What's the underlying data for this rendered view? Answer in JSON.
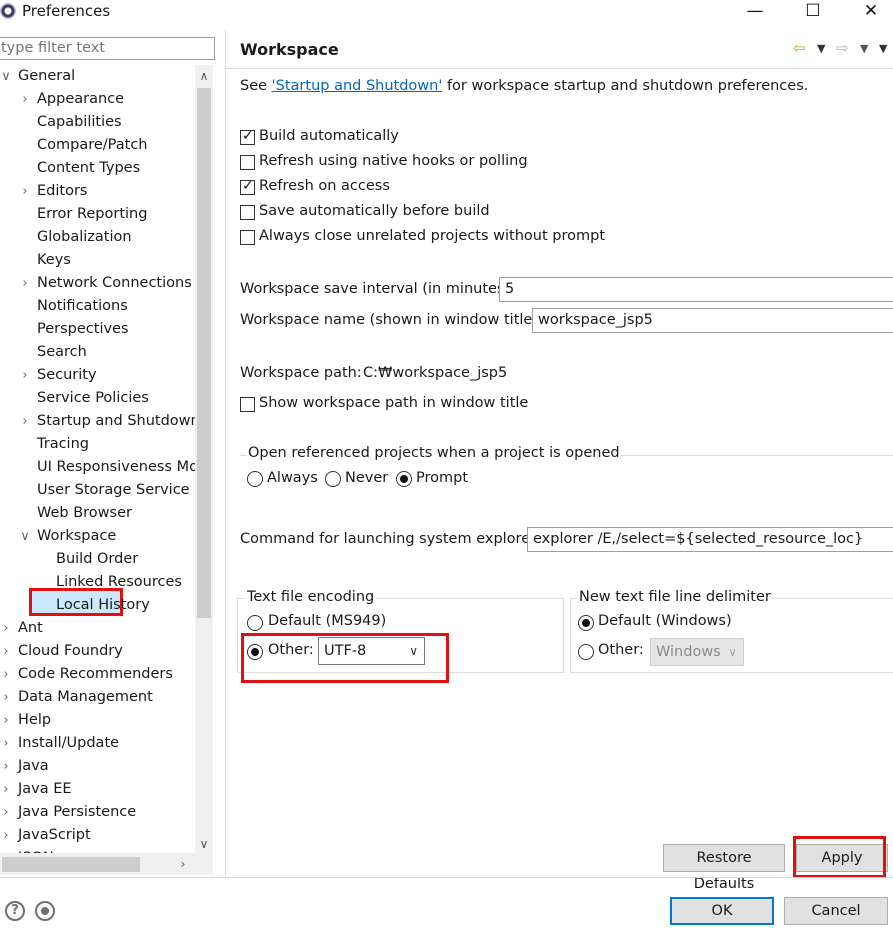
{
  "window": {
    "title": "Preferences",
    "minimize": "—",
    "maximize": "☐",
    "close": "✕"
  },
  "filter": {
    "placeholder": "type filter text"
  },
  "tree": [
    {
      "label": "General",
      "arrow": "∨",
      "level": 0
    },
    {
      "label": "Appearance",
      "arrow": "›",
      "level": 1
    },
    {
      "label": "Capabilities",
      "arrow": "",
      "level": 1
    },
    {
      "label": "Compare/Patch",
      "arrow": "",
      "level": 1
    },
    {
      "label": "Content Types",
      "arrow": "",
      "level": 1
    },
    {
      "label": "Editors",
      "arrow": "›",
      "level": 1
    },
    {
      "label": "Error Reporting",
      "arrow": "",
      "level": 1
    },
    {
      "label": "Globalization",
      "arrow": "",
      "level": 1
    },
    {
      "label": "Keys",
      "arrow": "",
      "level": 1
    },
    {
      "label": "Network Connections",
      "arrow": "›",
      "level": 1
    },
    {
      "label": "Notifications",
      "arrow": "",
      "level": 1
    },
    {
      "label": "Perspectives",
      "arrow": "",
      "level": 1
    },
    {
      "label": "Search",
      "arrow": "",
      "level": 1
    },
    {
      "label": "Security",
      "arrow": "›",
      "level": 1
    },
    {
      "label": "Service Policies",
      "arrow": "",
      "level": 1
    },
    {
      "label": "Startup and Shutdown",
      "arrow": "›",
      "level": 1
    },
    {
      "label": "Tracing",
      "arrow": "",
      "level": 1
    },
    {
      "label": "UI Responsiveness Mor",
      "arrow": "",
      "level": 1
    },
    {
      "label": "User Storage Service",
      "arrow": "",
      "level": 1
    },
    {
      "label": "Web Browser",
      "arrow": "",
      "level": 1
    },
    {
      "label": "Workspace",
      "arrow": "∨",
      "level": 1,
      "selected": true
    },
    {
      "label": "Build Order",
      "arrow": "",
      "level": 2
    },
    {
      "label": "Linked Resources",
      "arrow": "",
      "level": 2
    },
    {
      "label": "Local History",
      "arrow": "",
      "level": 2
    },
    {
      "label": "Ant",
      "arrow": "›",
      "level": 0
    },
    {
      "label": "Cloud Foundry",
      "arrow": "›",
      "level": 0
    },
    {
      "label": "Code Recommenders",
      "arrow": "›",
      "level": 0
    },
    {
      "label": "Data Management",
      "arrow": "›",
      "level": 0
    },
    {
      "label": "Help",
      "arrow": "›",
      "level": 0
    },
    {
      "label": "Install/Update",
      "arrow": "›",
      "level": 0
    },
    {
      "label": "Java",
      "arrow": "›",
      "level": 0
    },
    {
      "label": "Java EE",
      "arrow": "›",
      "level": 0
    },
    {
      "label": "Java Persistence",
      "arrow": "›",
      "level": 0
    },
    {
      "label": "JavaScript",
      "arrow": "›",
      "level": 0
    },
    {
      "label": "JSON",
      "arrow": "›",
      "level": 0
    }
  ],
  "page": {
    "title": "Workspace",
    "intro_prefix": "See ",
    "intro_link": "'Startup and Shutdown'",
    "intro_suffix": " for workspace startup and shutdown preferences.",
    "checkboxes": [
      {
        "label": "Build automatically",
        "checked": true
      },
      {
        "label": "Refresh using native hooks or polling",
        "checked": false
      },
      {
        "label": "Refresh on access",
        "checked": true
      },
      {
        "label": "Save automatically before build",
        "checked": false
      },
      {
        "label": "Always close unrelated projects without prompt",
        "checked": false
      }
    ],
    "save_interval_label": "Workspace save interval (in minutes):",
    "save_interval_value": "5",
    "name_label": "Workspace name (shown in window title):",
    "name_value": "workspace_jsp5",
    "path_label": "Workspace path:",
    "path_value": "C:₩workspace_jsp5",
    "show_path_label": "Show workspace path in window title",
    "open_ref_group": "Open referenced projects when a project is opened",
    "open_ref_options": [
      "Always",
      "Never",
      "Prompt"
    ],
    "open_ref_selected": "Prompt",
    "explorer_label": "Command for launching system explorer:",
    "explorer_value": "explorer /E,/select=${selected_resource_loc}",
    "encoding_group": "Text file encoding",
    "encoding_default": "Default (MS949)",
    "encoding_other": "Other:",
    "encoding_value": "UTF-8",
    "delimiter_group": "New text file line delimiter",
    "delimiter_default": "Default (Windows)",
    "delimiter_other": "Other:",
    "delimiter_value": "Windows",
    "restore_label": "Restore Defaults",
    "apply_label": "Apply"
  },
  "footer": {
    "ok_label": "OK",
    "cancel_label": "Cancel",
    "help_icon": "?"
  },
  "colors": {
    "highlight": "#e01010",
    "selection": "#cce8ff",
    "link": "#0066cc"
  }
}
